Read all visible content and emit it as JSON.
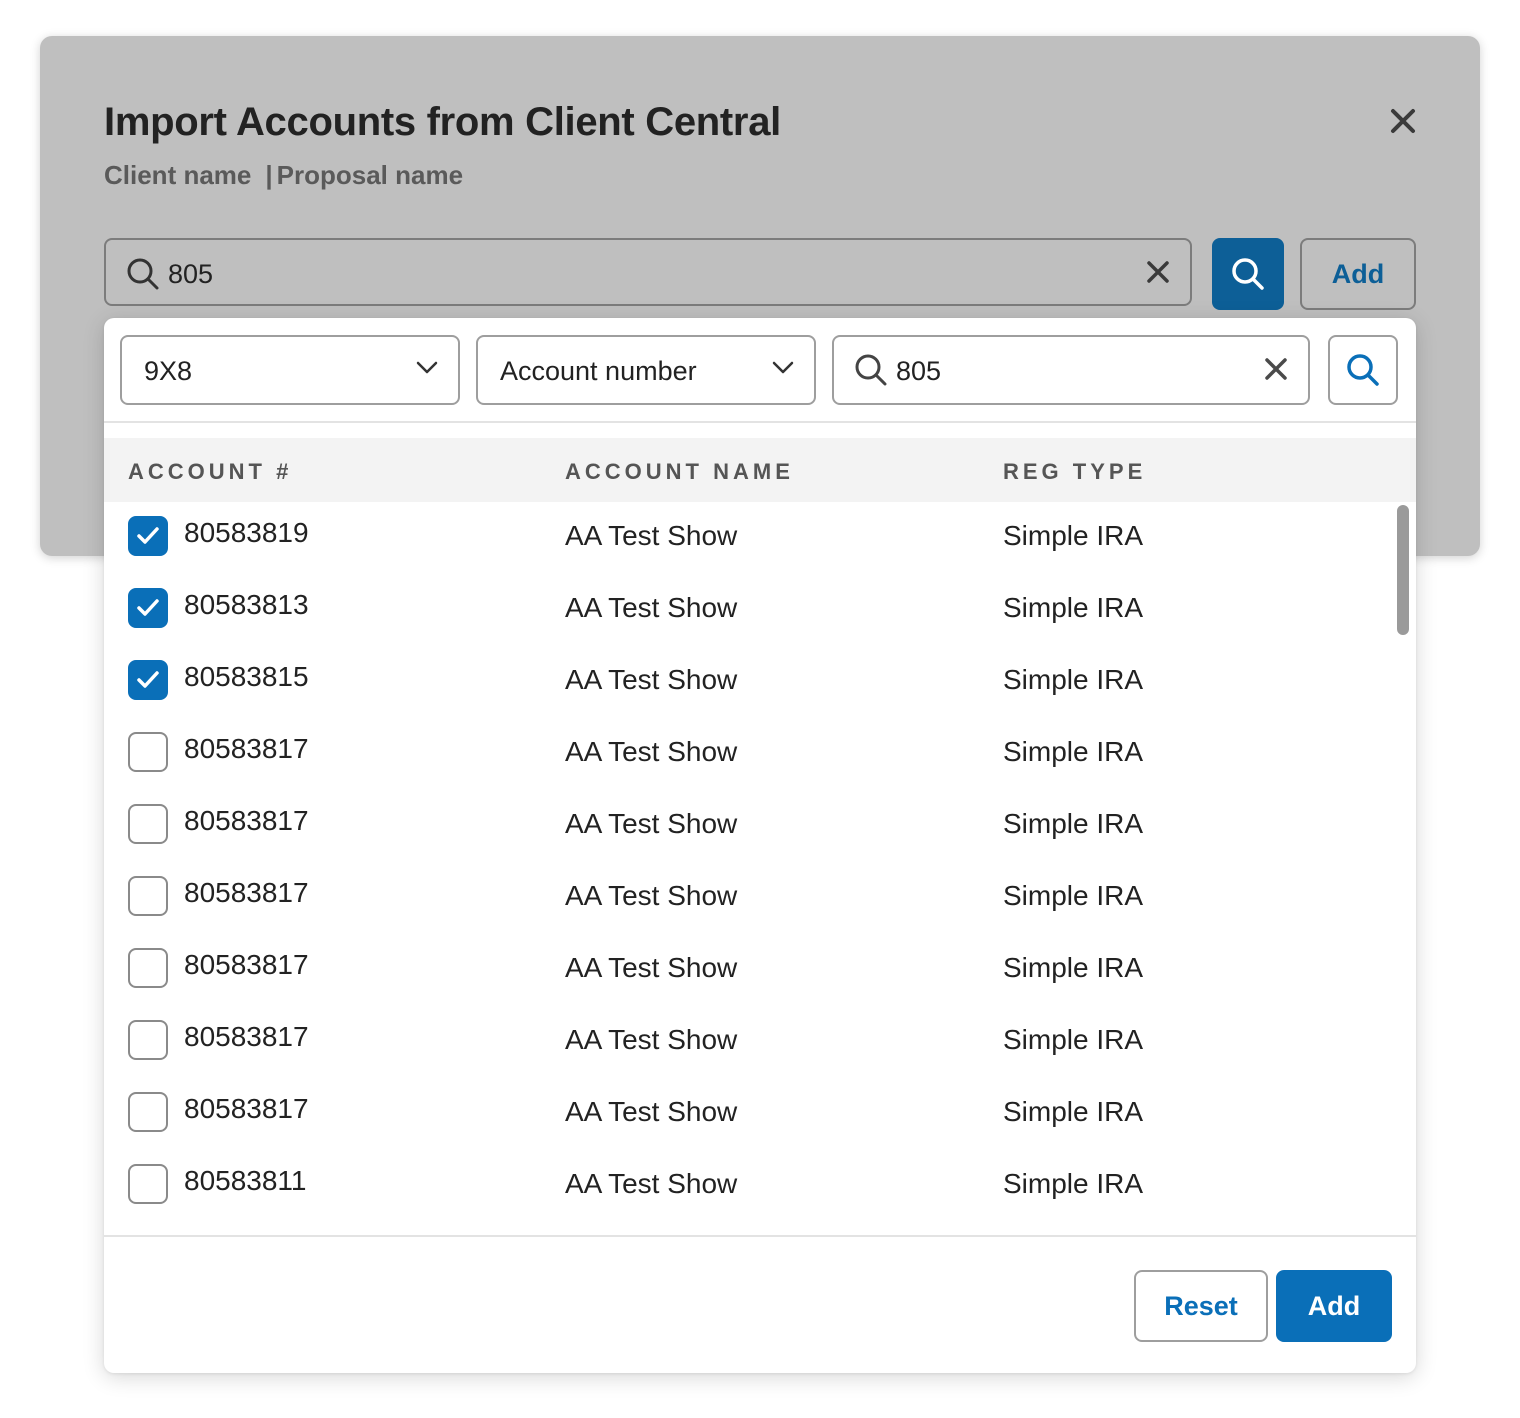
{
  "modal": {
    "title": "Import Accounts from Client Central",
    "client_name": "Client name",
    "separator": "|",
    "proposal_name": "Proposal name",
    "search": {
      "value": "805"
    },
    "add_label": "Add"
  },
  "filters": {
    "code_select": "9X8",
    "field_select": "Account number",
    "search_value": "805"
  },
  "table": {
    "headers": {
      "account": "ACCOUNT #",
      "name": "ACCOUNT NAME",
      "reg_type": "REG TYPE"
    },
    "rows": [
      {
        "checked": true,
        "account": "80583819",
        "name": "AA Test Show",
        "reg_type": "Simple IRA"
      },
      {
        "checked": true,
        "account": "80583813",
        "name": "AA Test Show",
        "reg_type": "Simple IRA"
      },
      {
        "checked": true,
        "account": "80583815",
        "name": "AA Test Show",
        "reg_type": "Simple IRA"
      },
      {
        "checked": false,
        "account": "80583817",
        "name": "AA Test Show",
        "reg_type": "Simple IRA"
      },
      {
        "checked": false,
        "account": "80583817",
        "name": "AA Test Show",
        "reg_type": "Simple IRA"
      },
      {
        "checked": false,
        "account": "80583817",
        "name": "AA Test Show",
        "reg_type": "Simple IRA"
      },
      {
        "checked": false,
        "account": "80583817",
        "name": "AA Test Show",
        "reg_type": "Simple IRA"
      },
      {
        "checked": false,
        "account": "80583817",
        "name": "AA Test Show",
        "reg_type": "Simple IRA"
      },
      {
        "checked": false,
        "account": "80583817",
        "name": "AA Test Show",
        "reg_type": "Simple IRA"
      },
      {
        "checked": false,
        "account": "80583811",
        "name": "AA Test Show",
        "reg_type": "Simple IRA"
      }
    ]
  },
  "footer": {
    "reset_label": "Reset",
    "add_label": "Add"
  },
  "icons": {
    "close": "close-icon",
    "search": "search-icon",
    "clear": "clear-icon",
    "chevron": "chevron-down-icon",
    "check": "checkmark-icon"
  },
  "colors": {
    "primary": "#0a6fb8",
    "primary_dark": "#0d5f97",
    "modal_overlay": "#bfbfbf"
  }
}
